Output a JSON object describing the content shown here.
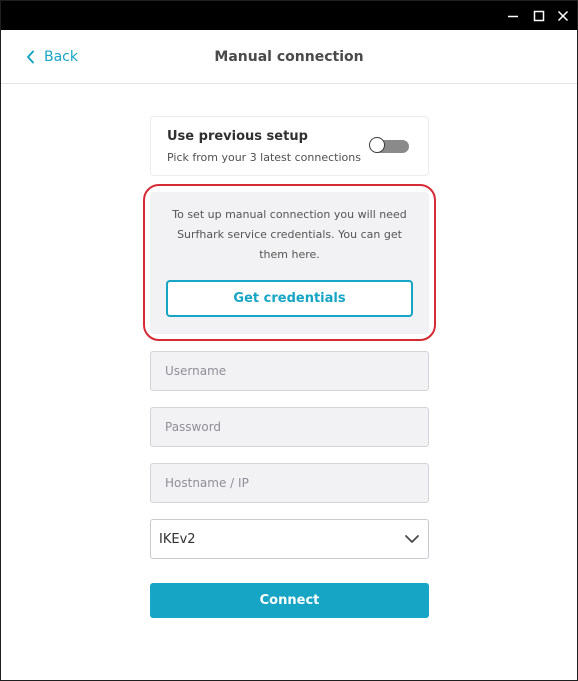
{
  "window": {
    "controls": [
      {
        "name": "minimize",
        "icon": "minimize-icon"
      },
      {
        "name": "maximize",
        "icon": "maximize-icon"
      },
      {
        "name": "close",
        "icon": "close-icon"
      }
    ]
  },
  "header": {
    "back_icon": "chevron-left-icon",
    "back_label": "Back",
    "title": "Manual connection"
  },
  "previous_setup": {
    "title": "Use previous setup",
    "subtitle": "Pick from your 3 latest connections",
    "toggle_on": false
  },
  "info": {
    "text": "To set up manual connection you will need Surfhark service credentials. You can get them here.",
    "button_label": "Get credentials"
  },
  "form": {
    "username": {
      "placeholder": "Username",
      "value": ""
    },
    "password": {
      "placeholder": "Password",
      "value": ""
    },
    "hostname": {
      "placeholder": "Hostname / IP",
      "value": ""
    },
    "protocol": {
      "selected": "IKEv2",
      "icon": "chevron-down-icon"
    },
    "connect_label": "Connect"
  },
  "colors": {
    "accent": "#16a5c4",
    "highlight_outline": "#d62a36",
    "titlebar": "#000000",
    "field_background": "#f2f2f4"
  }
}
